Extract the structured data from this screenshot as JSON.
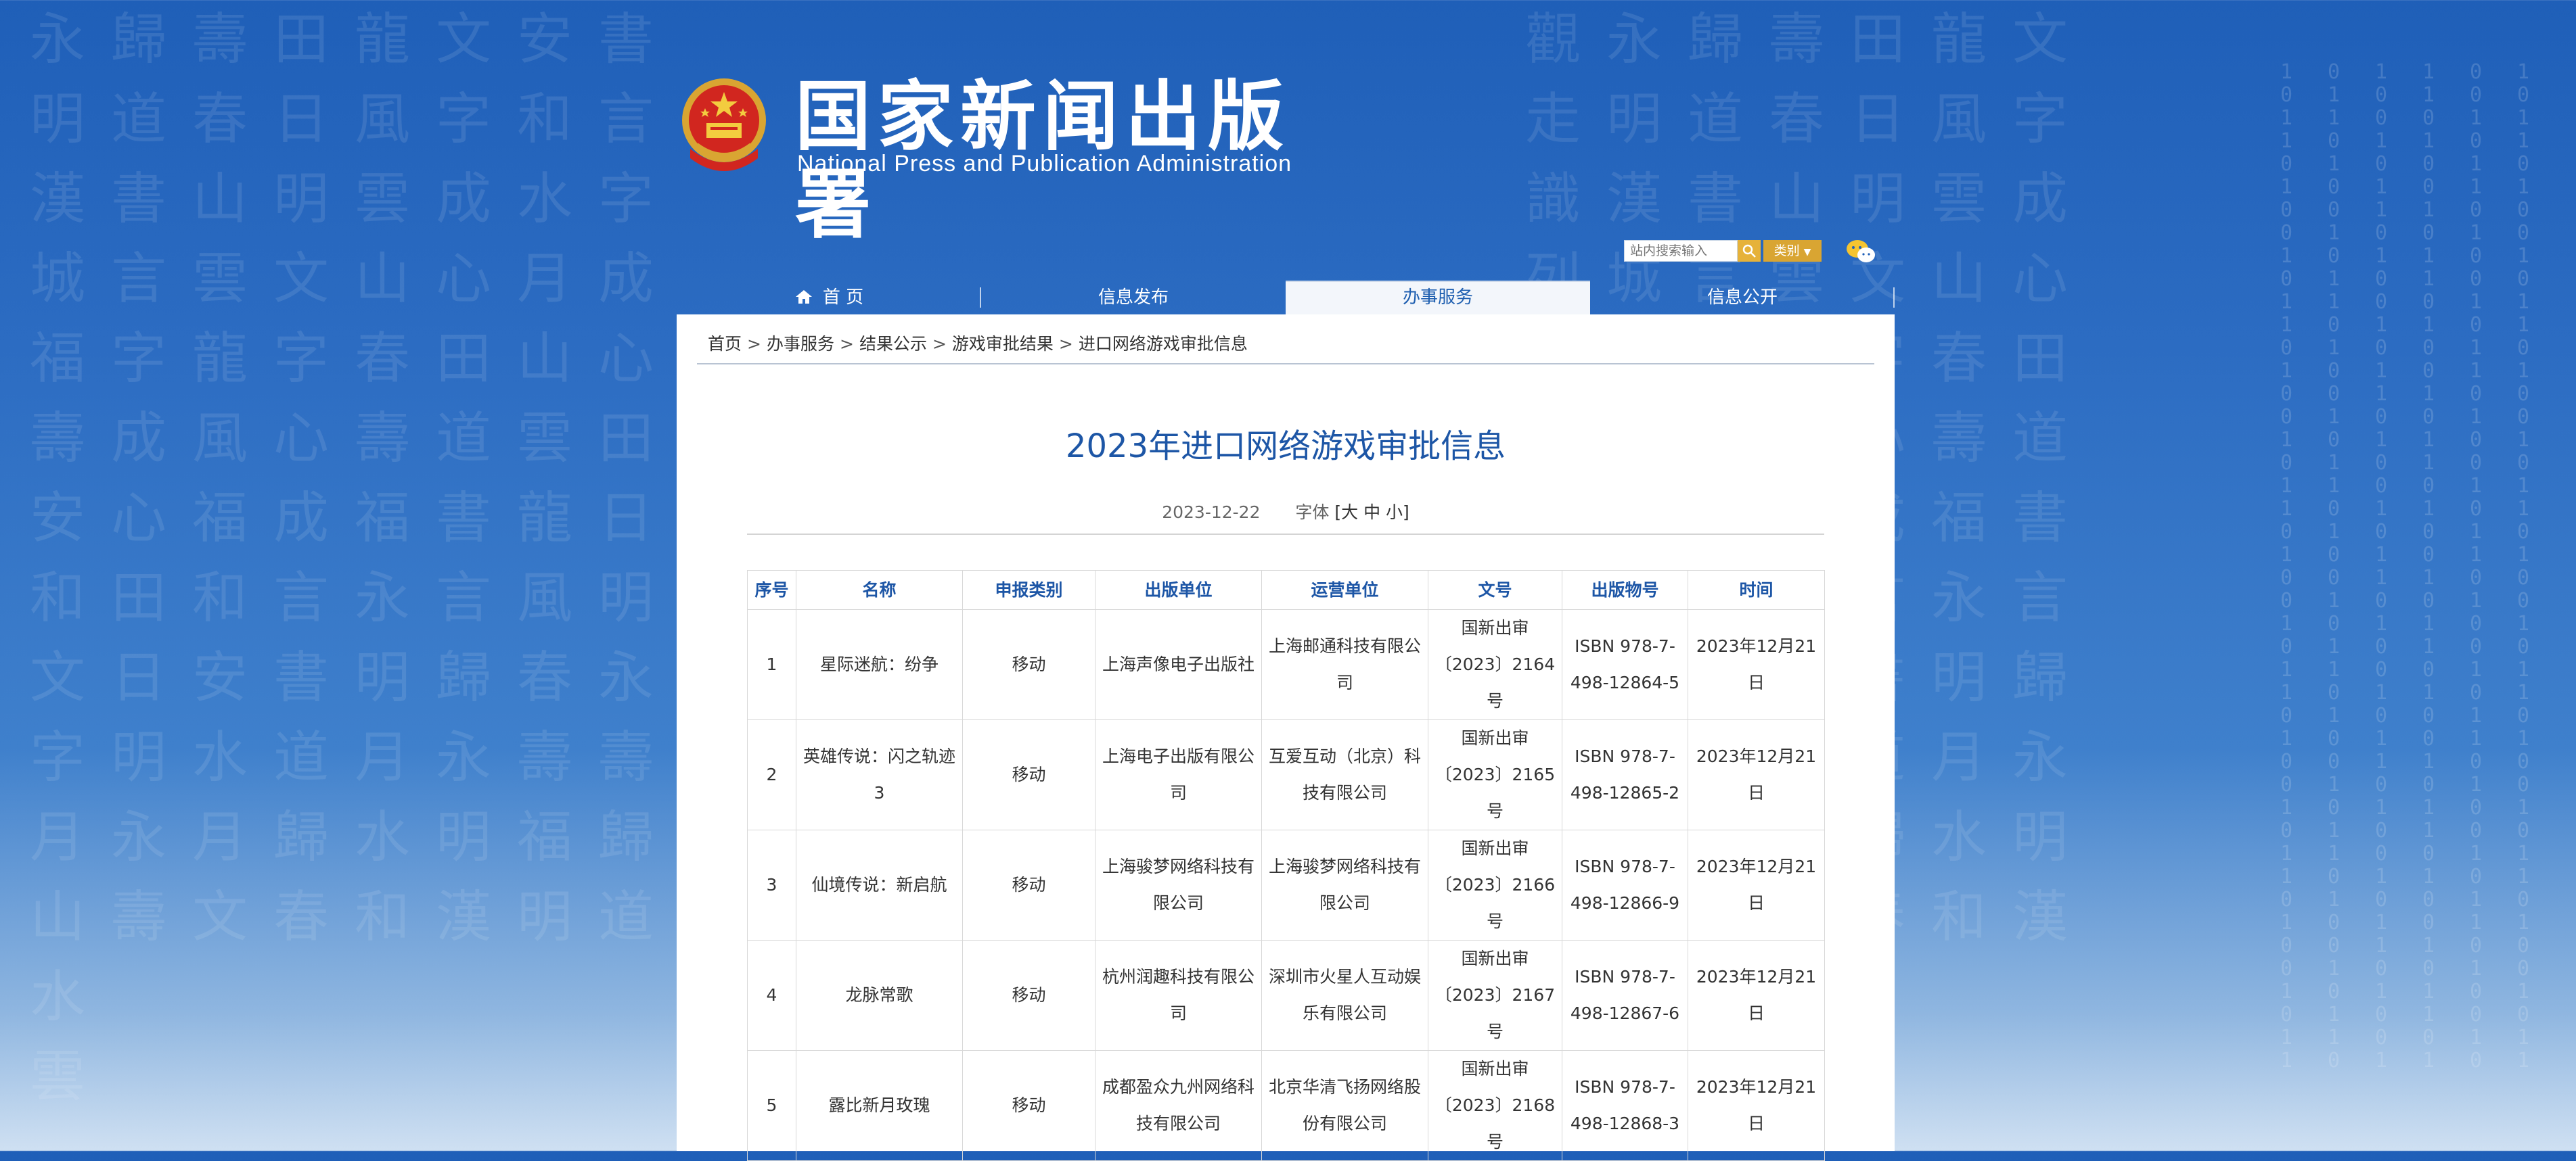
{
  "site": {
    "title": "国家新闻出版署",
    "subtitle": "National  Press and Publication Administration"
  },
  "search": {
    "placeholder": "站内搜索输入",
    "category_label": "类别"
  },
  "nav": [
    {
      "label": "首 页",
      "icon": "home-icon"
    },
    {
      "label": "信息发布"
    },
    {
      "label": "办事服务",
      "active": true
    },
    {
      "label": "信息公开"
    }
  ],
  "breadcrumb": [
    "首页",
    "办事服务",
    "结果公示",
    "游戏审批结果",
    "进口网络游戏审批信息"
  ],
  "breadcrumb_separator": ">",
  "article": {
    "title": "2023年进口网络游戏审批信息",
    "date": "2023-12-22",
    "font_label": "字体",
    "font_sizes": "[大 中 小]"
  },
  "table": {
    "headers": [
      "序号",
      "名称",
      "申报类别",
      "出版单位",
      "运营单位",
      "文号",
      "出版物号",
      "时间"
    ],
    "rows": [
      [
        "1",
        "星际迷航：纷争",
        "移动",
        "上海声像电子出版社",
        "上海邮通科技有限公司",
        "国新出审〔2023〕2164号",
        "ISBN 978-7-498-12864-5",
        "2023年12月21日"
      ],
      [
        "2",
        "英雄传说：闪之轨迹3",
        "移动",
        "上海电子出版有限公司",
        "互爱互动（北京）科技有限公司",
        "国新出审〔2023〕2165号",
        "ISBN 978-7-498-12865-2",
        "2023年12月21日"
      ],
      [
        "3",
        "仙境传说：新启航",
        "移动",
        "上海骏梦网络科技有限公司",
        "上海骏梦网络科技有限公司",
        "国新出审〔2023〕2166号",
        "ISBN 978-7-498-12866-9",
        "2023年12月21日"
      ],
      [
        "4",
        "龙脉常歌",
        "移动",
        "杭州润趣科技有限公司",
        "深圳市火星人互动娱乐有限公司",
        "国新出审〔2023〕2167号",
        "ISBN 978-7-498-12867-6",
        "2023年12月21日"
      ],
      [
        "5",
        "露比新月玫瑰",
        "移动",
        "成都盈众九州网络科技有限公司",
        "北京华清飞扬网络股份有限公司",
        "国新出审〔2023〕2168号",
        "ISBN 978-7-498-12868-3",
        "2023年12月21日"
      ]
    ]
  },
  "colors": {
    "background": "#2c6cc2",
    "title_blue": "#1d56a6",
    "search_button": "#e6b23a"
  }
}
